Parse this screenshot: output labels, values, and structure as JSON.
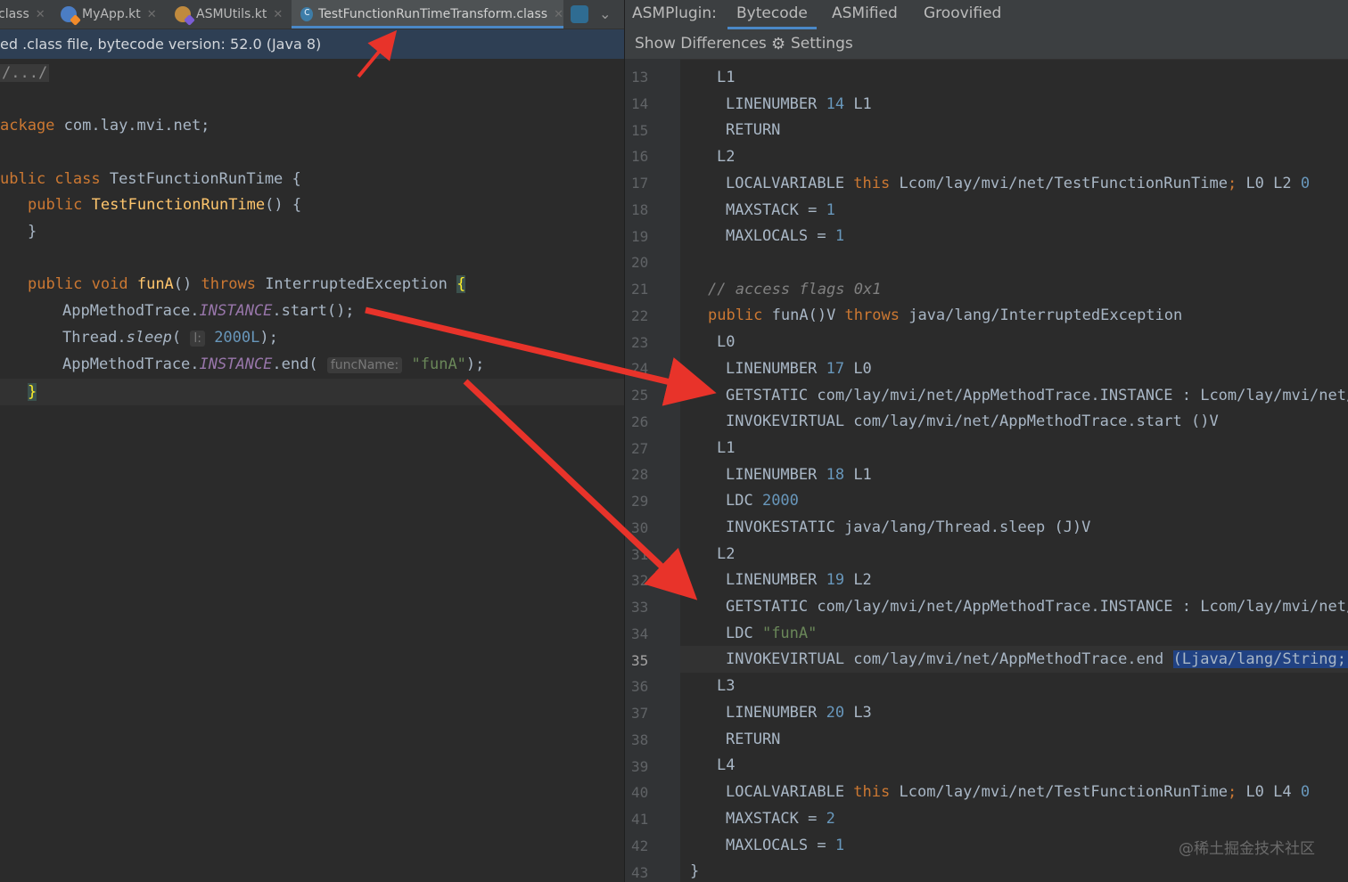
{
  "editor": {
    "tabs": [
      {
        "label": "class"
      },
      {
        "label": "MyApp.kt"
      },
      {
        "label": "ASMUtils.kt"
      },
      {
        "label": "TestFunctionRunTimeTransform.class"
      }
    ],
    "banner": "ed .class file, bytecode version: 52.0 (Java 8)",
    "folded": "/.../",
    "code": {
      "pkg_kw": "ackage",
      "pkg_name": " com.lay.mvi.net;",
      "cls_kw": "ublic class",
      "cls_name": " TestFunctionRunTime {",
      "ctor_kw": "public",
      "ctor_name": "TestFunctionRunTime",
      "ctor_rest": "() {",
      "close1": "}",
      "funa_kw1": "public void",
      "funa_name": "funA",
      "funa_paren": "()",
      "funa_throws": "throws",
      "funa_exc": " InterruptedException ",
      "funa_brace": "{",
      "l1_cls": "AppMethodTrace.",
      "l1_field": "INSTANCE",
      "l1_rest": ".start();",
      "l2_cls": "Thread.",
      "l2_m": "sleep",
      "l2_open": "( ",
      "l2_hint": "l:",
      "l2_num": "2000L",
      "l2_close": ");",
      "l3_cls": "AppMethodTrace.",
      "l3_field": "INSTANCE",
      "l3_rest": ".end( ",
      "l3_hint": "funcName:",
      "l3_str": "\"funA\"",
      "l3_close": ");",
      "close2": "}"
    }
  },
  "asm": {
    "plugin_label": "ASMPlugin:",
    "tabs": [
      "Bytecode",
      "ASMified",
      "Groovified"
    ],
    "show_diff": "Show Differences",
    "settings": "Settings",
    "line_numbers": [
      "13",
      "14",
      "15",
      "16",
      "17",
      "18",
      "19",
      "20",
      "21",
      "22",
      "23",
      "24",
      "25",
      "26",
      "27",
      "28",
      "29",
      "30",
      "31",
      "32",
      "33",
      "34",
      "35",
      "36",
      "37",
      "38",
      "39",
      "40",
      "41",
      "42",
      "43"
    ],
    "lines": {
      "l13": "L1",
      "l14a": "LINENUMBER ",
      "l14b": "14",
      "l14c": " L1",
      "l15": "RETURN",
      "l16": "L2",
      "l17a": "LOCALVARIABLE ",
      "l17b": "this",
      "l17c": " Lcom/lay/mvi/net/TestFunctionRunTime",
      "l17d": ";",
      "l17e": " L0 L2 ",
      "l17f": "0",
      "l18a": "MAXSTACK = ",
      "l18b": "1",
      "l19a": "MAXLOCALS = ",
      "l19b": "1",
      "l21": "// access flags 0x1",
      "l22a": "public",
      "l22b": " funA()V ",
      "l22c": "throws",
      "l22d": " java/lang/InterruptedException",
      "l23": "L0",
      "l24a": "LINENUMBER ",
      "l24b": "17",
      "l24c": " L0",
      "l25": "GETSTATIC com/lay/mvi/net/AppMethodTrace.INSTANCE : Lcom/lay/mvi/net/A",
      "l26": "INVOKEVIRTUAL com/lay/mvi/net/AppMethodTrace.start ()V",
      "l27": "L1",
      "l28a": "LINENUMBER ",
      "l28b": "18",
      "l28c": " L1",
      "l29a": "LDC ",
      "l29b": "2000",
      "l30": "INVOKESTATIC java/lang/Thread.sleep (J)V",
      "l31": "L2",
      "l32a": "LINENUMBER ",
      "l32b": "19",
      "l32c": " L2",
      "l33": "GETSTATIC com/lay/mvi/net/AppMethodTrace.INSTANCE : Lcom/lay/mvi/net/A",
      "l34a": "LDC ",
      "l34b": "\"funA\"",
      "l35a": "INVOKEVIRTUAL com/lay/mvi/net/AppMethodTrace.end ",
      "l35b": "(Ljava/lang/String;)V",
      "l36": "L3",
      "l37a": "LINENUMBER ",
      "l37b": "20",
      "l37c": " L3",
      "l38": "RETURN",
      "l39": "L4",
      "l40a": "LOCALVARIABLE ",
      "l40b": "this",
      "l40c": " Lcom/lay/mvi/net/TestFunctionRunTime",
      "l40d": ";",
      "l40e": " L0 L4 ",
      "l40f": "0",
      "l41a": "MAXSTACK = ",
      "l41b": "2",
      "l42a": "MAXLOCALS = ",
      "l42b": "1",
      "l43": "}"
    }
  },
  "watermark": "@稀土掘金技术社区",
  "colors": {
    "arrow": "#e8332a",
    "accent": "#4a88c7"
  }
}
